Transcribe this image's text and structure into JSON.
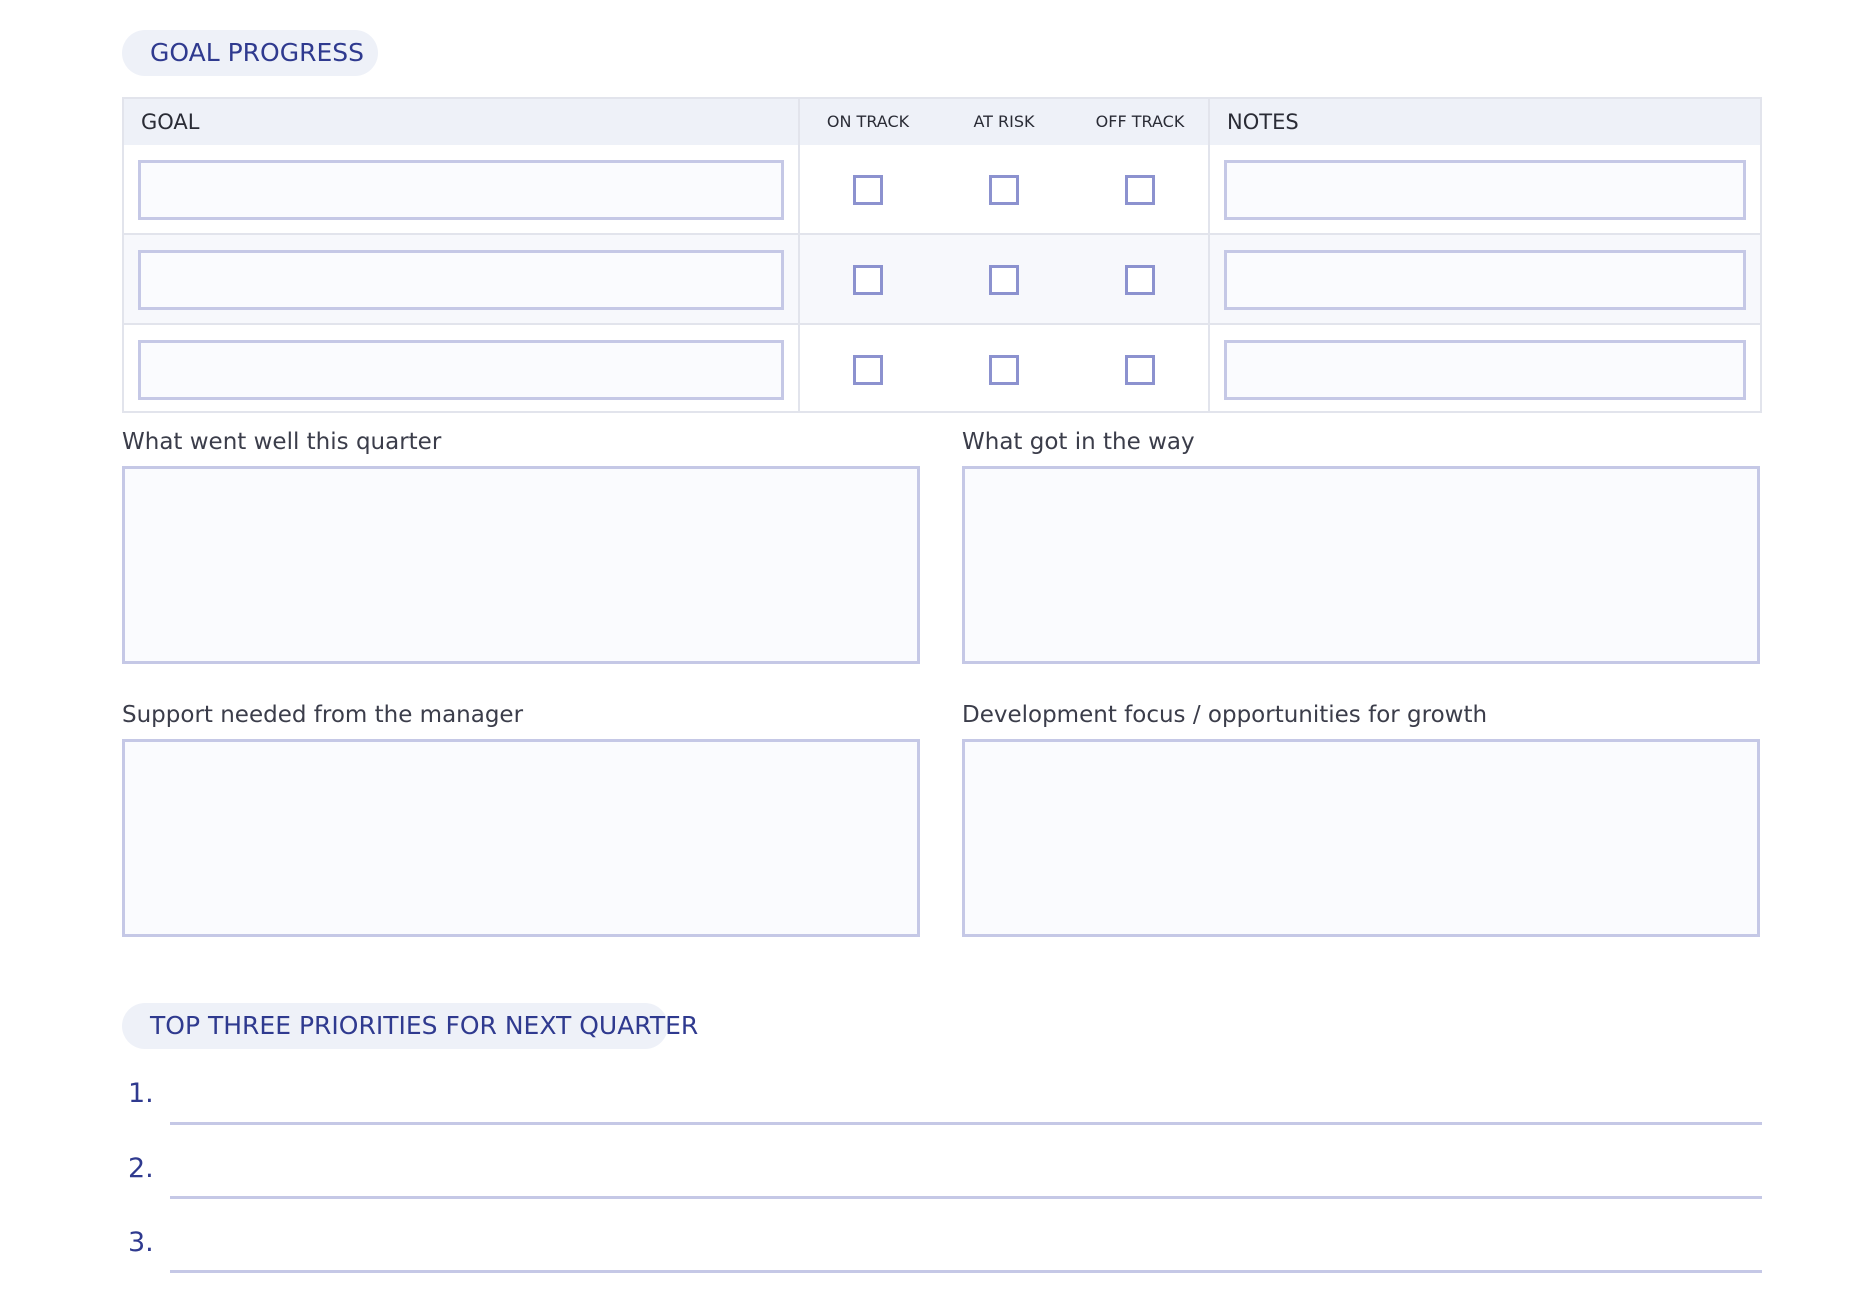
{
  "goal_progress": {
    "title": "GOAL PROGRESS",
    "columns": {
      "goal": "GOAL",
      "on_track": "ON TRACK",
      "at_risk": "AT RISK",
      "off_track": "OFF TRACK",
      "notes": "NOTES"
    },
    "rows": [
      {
        "goal": "",
        "on_track": false,
        "at_risk": false,
        "off_track": false,
        "notes": ""
      },
      {
        "goal": "",
        "on_track": false,
        "at_risk": false,
        "off_track": false,
        "notes": ""
      },
      {
        "goal": "",
        "on_track": false,
        "at_risk": false,
        "off_track": false,
        "notes": ""
      }
    ]
  },
  "reflection": {
    "went_well": {
      "label": "What went well this quarter",
      "value": ""
    },
    "got_in_way": {
      "label": "What got in the way",
      "value": ""
    },
    "support_needed": {
      "label": "Support needed from the manager",
      "value": ""
    },
    "development_focus": {
      "label": "Development focus / opportunities for growth",
      "value": ""
    }
  },
  "priorities": {
    "title": "TOP THREE PRIORITIES FOR NEXT QUARTER",
    "items": [
      {
        "number": "1.",
        "value": ""
      },
      {
        "number": "2.",
        "value": ""
      },
      {
        "number": "3.",
        "value": ""
      }
    ]
  },
  "colors": {
    "accent": "#2f3a8f",
    "pill_background": "#eef1f8",
    "field_border": "#c5c8e6",
    "checkbox_border": "#8c92cf"
  }
}
